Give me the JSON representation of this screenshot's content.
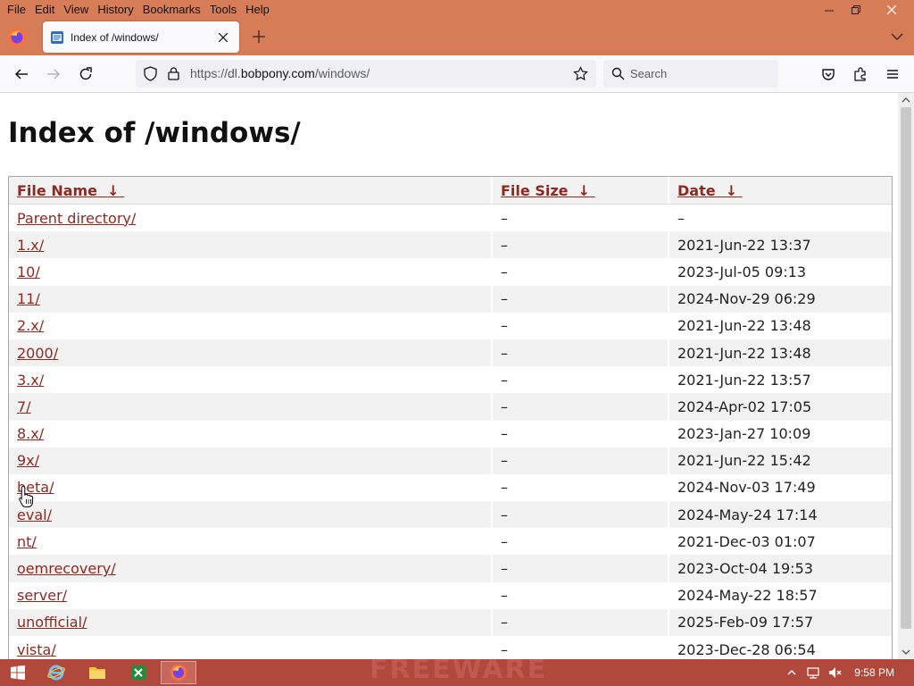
{
  "menu": [
    "File",
    "Edit",
    "View",
    "History",
    "Bookmarks",
    "Tools",
    "Help"
  ],
  "tab": {
    "title": "Index of /windows/"
  },
  "urlbar": {
    "prefix": "https://dl.",
    "host": "bobpony.com",
    "path": "/windows/"
  },
  "search": {
    "placeholder": "Search"
  },
  "page": {
    "title": "Index of /windows/",
    "columns": {
      "name": "File Name",
      "size": "File Size",
      "date": "Date",
      "sort_arrow": "↓"
    },
    "rows": [
      {
        "name": "Parent directory/",
        "size": "–",
        "date": "–"
      },
      {
        "name": "1.x/",
        "size": "–",
        "date": "2021-Jun-22 13:37"
      },
      {
        "name": "10/",
        "size": "–",
        "date": "2023-Jul-05 09:13"
      },
      {
        "name": "11/",
        "size": "–",
        "date": "2024-Nov-29 06:29"
      },
      {
        "name": "2.x/",
        "size": "–",
        "date": "2021-Jun-22 13:48"
      },
      {
        "name": "2000/",
        "size": "–",
        "date": "2021-Jun-22 13:48"
      },
      {
        "name": "3.x/",
        "size": "–",
        "date": "2021-Jun-22 13:57"
      },
      {
        "name": "7/",
        "size": "–",
        "date": "2024-Apr-02 17:05"
      },
      {
        "name": "8.x/",
        "size": "–",
        "date": "2023-Jan-27 10:09"
      },
      {
        "name": "9x/",
        "size": "–",
        "date": "2021-Jun-22 15:42"
      },
      {
        "name": "beta/",
        "size": "–",
        "date": "2024-Nov-03 17:49"
      },
      {
        "name": "eval/",
        "size": "–",
        "date": "2024-May-24 17:14"
      },
      {
        "name": "nt/",
        "size": "–",
        "date": "2021-Dec-03 01:07"
      },
      {
        "name": "oemrecovery/",
        "size": "–",
        "date": "2023-Oct-04 19:53"
      },
      {
        "name": "server/",
        "size": "–",
        "date": "2024-May-22 18:57"
      },
      {
        "name": "unofficial/",
        "size": "–",
        "date": "2025-Feb-09 17:57"
      },
      {
        "name": "vista/",
        "size": "–",
        "date": "2023-Dec-28 06:54"
      }
    ]
  },
  "taskbar": {
    "watermark": "FREEWARE",
    "clock": "9:58 PM"
  },
  "colors": {
    "chrome": "#d67c57",
    "taskbar": "#b0483c",
    "link": "#8b2a23"
  }
}
